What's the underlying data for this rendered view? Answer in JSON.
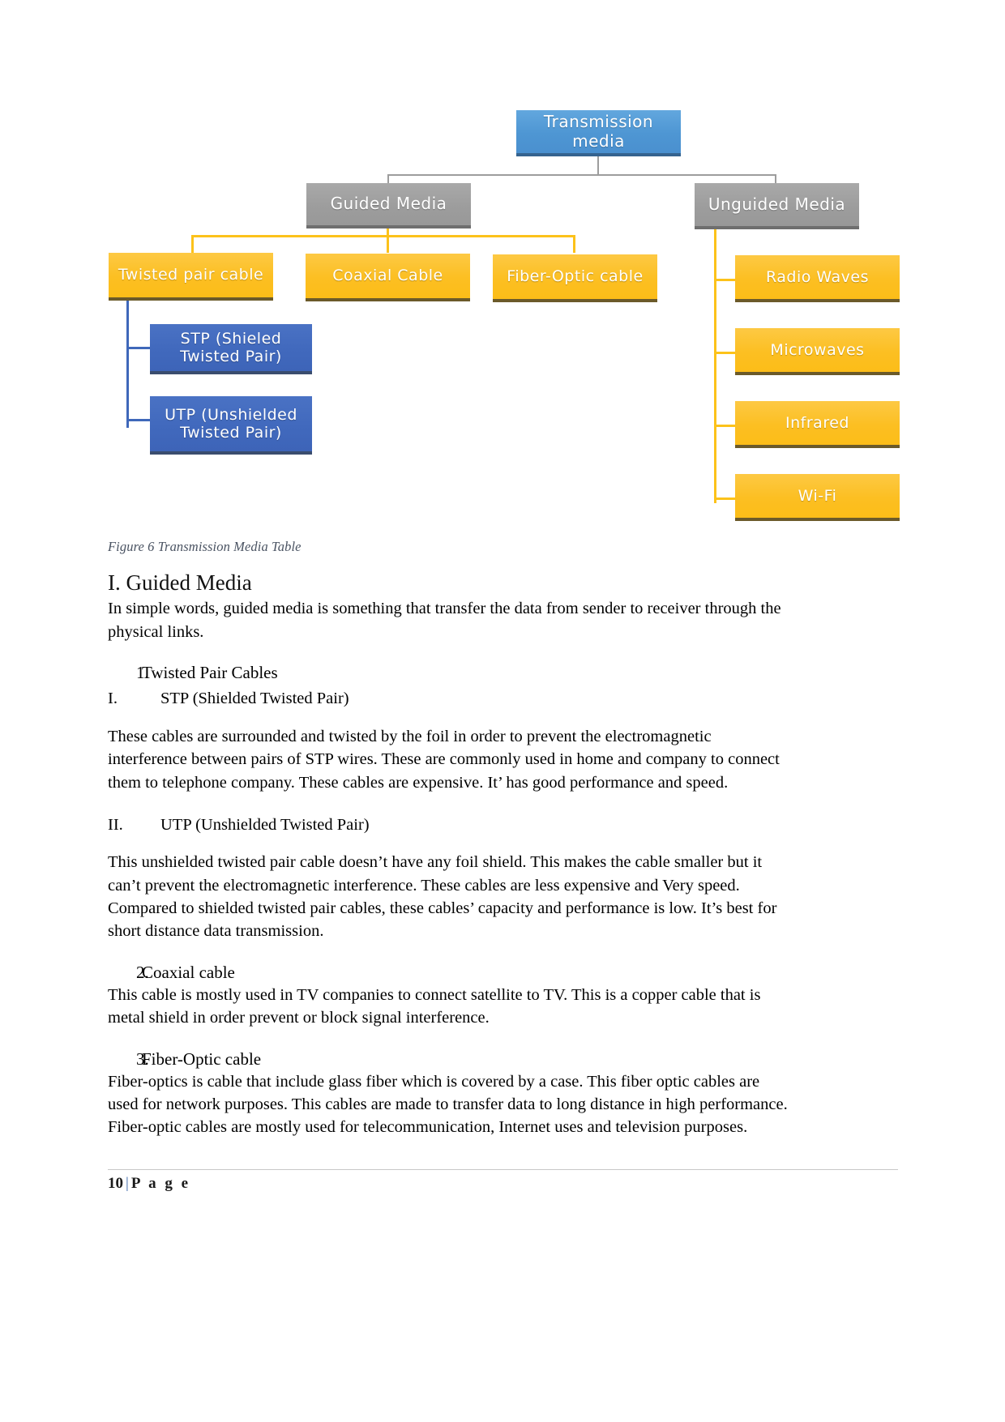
{
  "diagram": {
    "root": {
      "label": "Transmission media"
    },
    "branches": [
      {
        "label": "Guided Media"
      },
      {
        "label": "Unguided Media"
      }
    ],
    "guided_children": [
      {
        "label": "Twisted pair cable"
      },
      {
        "label": "Coaxial Cable"
      },
      {
        "label": "Fiber-Optic cable"
      }
    ],
    "twisted_pair_children": [
      {
        "label": "STP (Shieled Twisted Pair)"
      },
      {
        "label": "UTP (Unshielded Twisted Pair)"
      }
    ],
    "unguided_children": [
      {
        "label": "Radio Waves"
      },
      {
        "label": "Microwaves"
      },
      {
        "label": "Infrared"
      },
      {
        "label": "Wi-Fi"
      }
    ],
    "colors": {
      "root": "#4a90cf",
      "branch": "#9d9d9d",
      "yellow": "#fcbf22",
      "darkblue": "#4169bd"
    }
  },
  "caption": "Figure 6 Transmission Media Table",
  "content": {
    "heading": "I. Guided Media",
    "intro": "In simple words, guided media is something that transfer the data from sender to receiver through the physical links.",
    "item1_marker": "1.",
    "item1_label": "Twisted Pair Cables",
    "roman1_marker": "I.",
    "roman1_label": "STP (Shielded Twisted Pair)",
    "stp_paragraph": "These cables are surrounded and twisted by the foil in order to prevent the electromagnetic interference between pairs of STP wires. These are commonly used in home and company to connect them to telephone company. These cables are expensive. It’ has good performance and speed.",
    "roman2_marker": "II.",
    "roman2_label": "UTP (Unshielded Twisted Pair)",
    "utp_paragraph": "This unshielded twisted pair cable doesn’t have any foil shield. This makes the cable smaller but it can’t prevent the electromagnetic interference. These cables are less expensive and Very speed. Compared to shielded twisted pair cables, these cables’ capacity and performance is low. It’s best for short distance data transmission.",
    "item2_marker": "2.",
    "item2_label": "Coaxial cable",
    "coaxial_paragraph": "This cable is mostly used in TV companies to connect satellite to TV. This is a copper cable that is metal shield in order prevent or block signal interference.",
    "item3_marker": "3.",
    "item3_label": "Fiber-Optic cable",
    "fiber_paragraph": "Fiber-optics is cable that include glass fiber which is covered by a case. This fiber optic cables are used for network purposes. This cables are made to transfer data to long distance in high performance. Fiber-optic cables are mostly used for telecommunication, Internet uses and television purposes."
  },
  "footer": {
    "page_number": "10",
    "separator": "|",
    "page_word": "P a g e"
  }
}
